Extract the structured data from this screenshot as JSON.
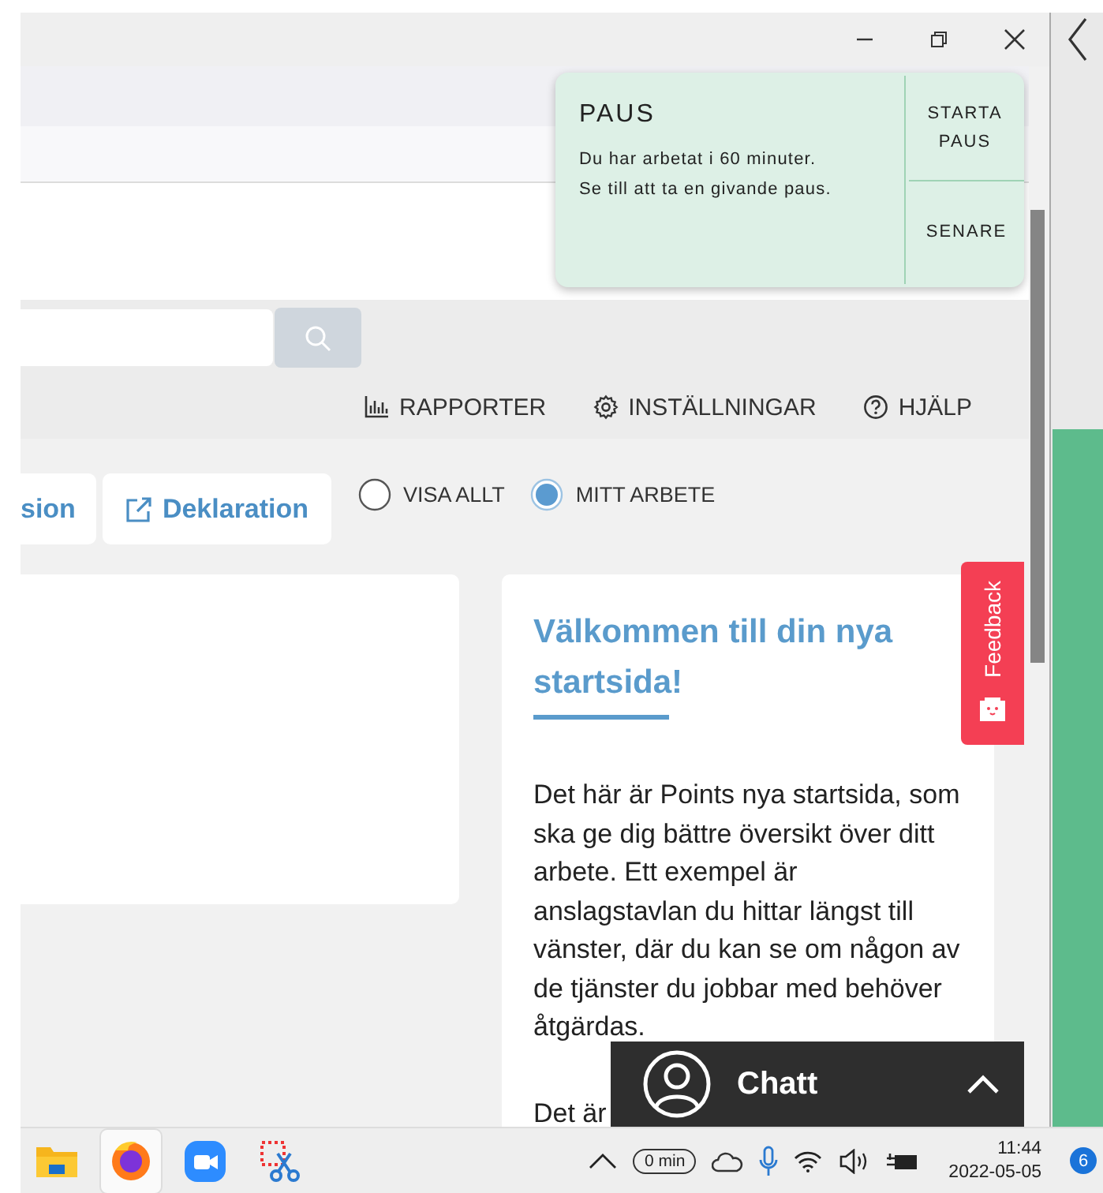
{
  "popup": {
    "title": "PAUS",
    "message": [
      "Du har arbetat i 60 minuter.",
      "Se till att ta en givande paus."
    ],
    "actions": [
      "STARTA PAUS",
      "SENARE"
    ]
  },
  "nav_links": [
    {
      "label": "RAPPORTER",
      "kind": "reports"
    },
    {
      "label": "INSTÄLLNINGAR",
      "kind": "settings"
    },
    {
      "label": "HJÄLP",
      "kind": "help"
    }
  ],
  "tabs": [
    {
      "label": "sion",
      "kind": "plain"
    },
    {
      "label": "Deklaration",
      "kind": "external"
    }
  ],
  "filters": [
    {
      "label": "VISA ALLT",
      "selected": false
    },
    {
      "label": "MITT ARBETE",
      "selected": true
    }
  ],
  "welcome": {
    "title": "Välkommen till din nya startsida!",
    "paragraphs": [
      "Det här är Points nya startsida, som ska ge dig bättre översikt över ditt arbete. Ett exempel är anslagstavlan du hittar längst till vänster, där du kan se om någon av de tjänster du jobbar med behöver åtgärdas.",
      "Det är"
    ]
  },
  "feedback": {
    "label": "Feedback"
  },
  "chat": {
    "label": "Chatt"
  },
  "taskbar": {
    "apps": [
      {
        "kind": "folder",
        "active": false
      },
      {
        "kind": "browser",
        "active": true
      },
      {
        "kind": "video",
        "active": false
      },
      {
        "kind": "snip",
        "active": false
      }
    ],
    "timer": "0 min",
    "time": "11:44",
    "date": "2022-05-05",
    "notifications": "6"
  }
}
